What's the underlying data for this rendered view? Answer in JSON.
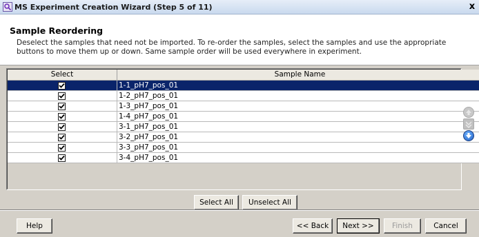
{
  "window": {
    "title": "MS Experiment Creation Wizard (Step 5 of 11)",
    "close_glyph": "x",
    "icon": "magnifier-app-icon"
  },
  "header": {
    "title": "Sample Reordering",
    "description": "Deselect the samples that need not be imported. To re-order the samples, select the samples and use the appropriate buttons to move them up or down. Same sample order will be used everywhere in experiment."
  },
  "grid": {
    "columns": [
      "Select",
      "Sample Name"
    ],
    "rows": [
      {
        "checked": true,
        "name": "1-1_pH7_pos_01",
        "selected": true
      },
      {
        "checked": true,
        "name": "1-2_pH7_pos_01",
        "selected": false
      },
      {
        "checked": true,
        "name": "1-3_pH7_pos_01",
        "selected": false
      },
      {
        "checked": true,
        "name": "1-4_pH7_pos_01",
        "selected": false
      },
      {
        "checked": true,
        "name": "3-1_pH7_pos_01",
        "selected": false
      },
      {
        "checked": true,
        "name": "3-2_pH7_pos_01",
        "selected": false
      },
      {
        "checked": true,
        "name": "3-3_pH7_pos_01",
        "selected": false
      },
      {
        "checked": true,
        "name": "3-4_pH7_pos_01",
        "selected": false
      }
    ]
  },
  "side_buttons": [
    "move-up-icon",
    "move-top-icon",
    "move-down-icon"
  ],
  "selection_buttons": {
    "select_all": "Select All",
    "unselect_all": "Unselect All"
  },
  "footer": {
    "help": "Help",
    "back": "<< Back",
    "next": "Next >>",
    "finish": "Finish",
    "cancel": "Cancel"
  },
  "colors": {
    "selection": "#0a246a",
    "dialog_bg": "#d4d0c8"
  }
}
